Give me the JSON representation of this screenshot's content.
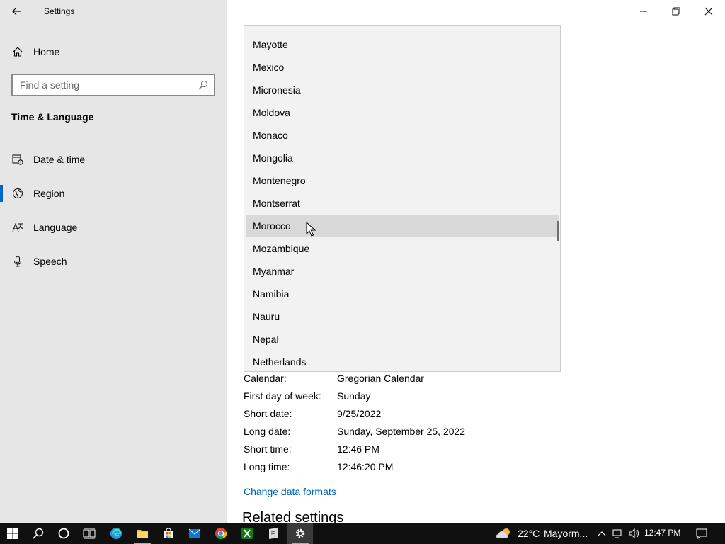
{
  "app": {
    "title": "Settings"
  },
  "sidebar": {
    "home_label": "Home",
    "search_placeholder": "Find a setting",
    "section_title": "Time & Language",
    "items": [
      {
        "label": "Date & time",
        "icon": "date-time-icon",
        "selected": false
      },
      {
        "label": "Region",
        "icon": "region-icon",
        "selected": true
      },
      {
        "label": "Language",
        "icon": "language-icon",
        "selected": false
      },
      {
        "label": "Speech",
        "icon": "microphone-icon",
        "selected": false
      }
    ]
  },
  "dropdown": {
    "items": [
      "Mayotte",
      "Mexico",
      "Micronesia",
      "Moldova",
      "Monaco",
      "Mongolia",
      "Montenegro",
      "Montserrat",
      "Morocco",
      "Mozambique",
      "Myanmar",
      "Namibia",
      "Nauru",
      "Nepal",
      "Netherlands"
    ],
    "hovered": "Morocco"
  },
  "details": [
    {
      "label": "Calendar:",
      "value": "Gregorian Calendar"
    },
    {
      "label": "First day of week:",
      "value": "Sunday"
    },
    {
      "label": "Short date:",
      "value": "9/25/2022"
    },
    {
      "label": "Long date:",
      "value": "Sunday, September 25, 2022"
    },
    {
      "label": "Short time:",
      "value": "12:46 PM"
    },
    {
      "label": "Long time:",
      "value": "12:46:20 PM"
    }
  ],
  "change_link": "Change data formats",
  "related_heading": "Related settings",
  "taskbar": {
    "weather": "22°C",
    "location": "Mayorm...",
    "clock": "12:47 PM",
    "accent": "#76b9ed",
    "background": "#101010"
  },
  "colors": {
    "selection_indicator": "#0067c0",
    "link": "#0063b1",
    "sidebar_bg": "#e6e6e6"
  }
}
